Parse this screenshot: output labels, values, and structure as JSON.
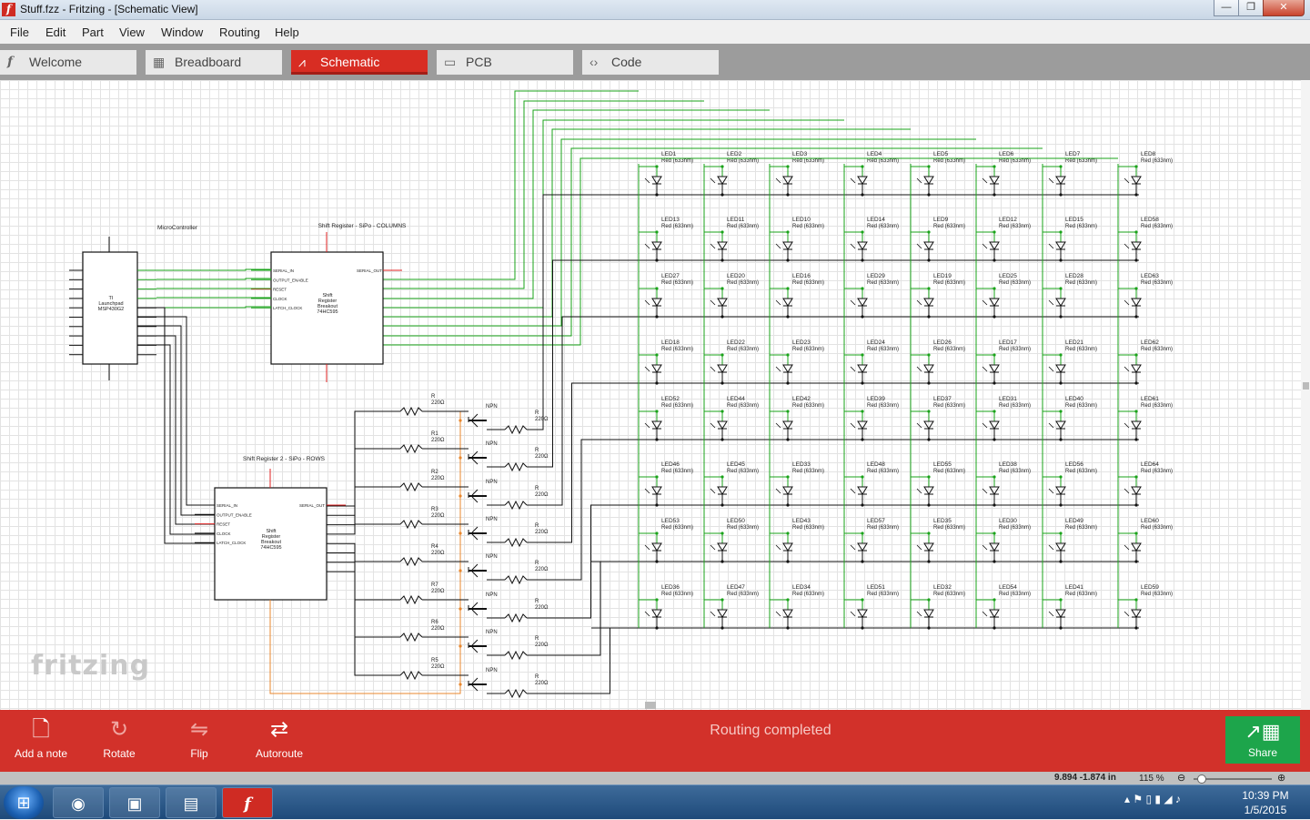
{
  "window": {
    "title": "Stuff.fzz - Fritzing - [Schematic View]",
    "app_icon": "f",
    "min": "—",
    "max": "❐",
    "close": "✕"
  },
  "menu": [
    "File",
    "Edit",
    "Part",
    "View",
    "Window",
    "Routing",
    "Help"
  ],
  "tabs": [
    {
      "label": "Welcome",
      "icon": "fritzing-icon"
    },
    {
      "label": "Breadboard",
      "icon": "breadboard-icon"
    },
    {
      "label": "Schematic",
      "icon": "schematic-icon",
      "active": true
    },
    {
      "label": "PCB",
      "icon": "pcb-icon"
    },
    {
      "label": "Code",
      "icon": "code-icon"
    }
  ],
  "schematic": {
    "mcu": {
      "title": "MicroController",
      "body": [
        "TI",
        "Launchpad",
        "MSP430G2"
      ]
    },
    "sr1": {
      "title": "Shift Register - SiPo - COLUMNS",
      "body": [
        "Shift",
        "Register",
        "Breakout",
        "74HC595"
      ]
    },
    "sr2": {
      "title": "Shift Register 2 - SiPo - ROWS",
      "body": [
        "Shift",
        "Register",
        "Breakout",
        "74HC595"
      ]
    },
    "sr_pins_left": [
      "SERIAL_IN",
      "OUTPUT_ENABLE",
      "RESET",
      "CLOCK",
      "LATCH_CLOCK"
    ],
    "sr_pin_right": "SERIAL_OUT",
    "led_sub": "Red (633nm)",
    "led_grid": [
      [
        "LED1",
        "LED2",
        "LED3",
        "LED4",
        "LED5",
        "LED6",
        "LED7",
        "LED8"
      ],
      [
        "LED13",
        "LED11",
        "LED10",
        "LED14",
        "LED9",
        "LED12",
        "LED15",
        "LED58"
      ],
      [
        "LED27",
        "LED20",
        "LED16",
        "LED29",
        "LED19",
        "LED25",
        "LED28",
        "LED63"
      ],
      [
        "LED18",
        "LED22",
        "LED23",
        "LED24",
        "LED26",
        "LED17",
        "LED21",
        "LED62"
      ],
      [
        "LED52",
        "LED44",
        "LED42",
        "LED39",
        "LED37",
        "LED31",
        "LED40",
        "LED61"
      ],
      [
        "LED46",
        "LED45",
        "LED33",
        "LED48",
        "LED55",
        "LED38",
        "LED56",
        "LED64"
      ],
      [
        "LED53",
        "LED50",
        "LED43",
        "LED57",
        "LED35",
        "LED30",
        "LED49",
        "LED60"
      ],
      [
        "LED36",
        "LED47",
        "LED34",
        "LED51",
        "LED32",
        "LED54",
        "LED41",
        "LED59"
      ]
    ],
    "base_resistors": [
      "R",
      "R1",
      "R2",
      "R3",
      "R4",
      "R7",
      "R6",
      "R5"
    ],
    "collector_resistor": "R",
    "resistor_value": "220Ω",
    "transistor": "NPN"
  },
  "logo": "fritzing",
  "toolbar": {
    "add_note": "Add a note",
    "rotate": "Rotate",
    "flip": "Flip",
    "autoroute": "Autoroute",
    "share": "Share",
    "status": "Routing completed"
  },
  "statusbar": {
    "coords": "9.894 -1.874 in",
    "zoom": "115 %"
  },
  "taskbar": {
    "time": "10:39 PM",
    "date": "1/5/2015",
    "items": [
      "chrome-icon",
      "network-app-icon",
      "explorer-icon",
      "fritzing-icon"
    ]
  },
  "colors": {
    "accent": "#d82d23",
    "wire": "#1aa31a",
    "ground_wire": "#e8872e",
    "share": "#1da54b"
  }
}
